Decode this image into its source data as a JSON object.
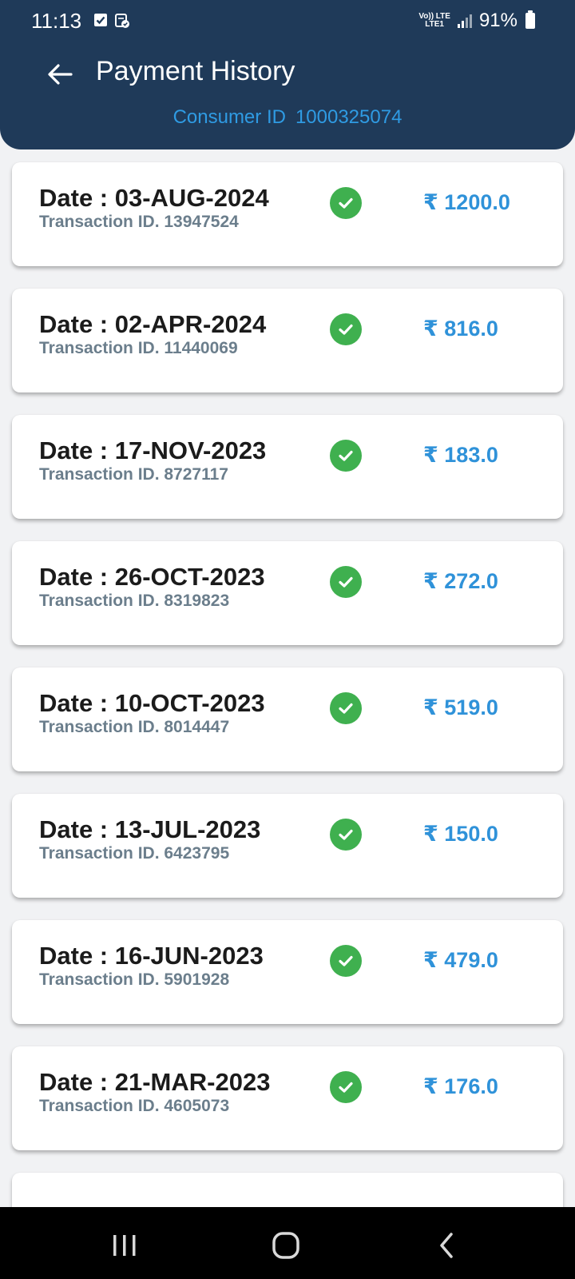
{
  "status_bar": {
    "time": "11:13",
    "network_top": "Vo)) LTE",
    "network_sub": "LTE1",
    "battery": "91%"
  },
  "header": {
    "title": "Payment History",
    "consumer_label": "Consumer ID",
    "consumer_id": "1000325074"
  },
  "colors": {
    "header_bg": "#1f3a59",
    "accent": "#2f92d9",
    "success": "#3fb04f"
  },
  "payments": [
    {
      "date": "Date : 03-AUG-2024",
      "transaction": "Transaction ID. 13947524",
      "amount": "₹ 1200.0",
      "status_icon": "check-circle-icon"
    },
    {
      "date": "Date : 02-APR-2024",
      "transaction": "Transaction ID. 11440069",
      "amount": "₹ 816.0",
      "status_icon": "check-circle-icon"
    },
    {
      "date": "Date : 17-NOV-2023",
      "transaction": "Transaction ID. 8727117",
      "amount": "₹ 183.0",
      "status_icon": "check-circle-icon"
    },
    {
      "date": "Date : 26-OCT-2023",
      "transaction": "Transaction ID. 8319823",
      "amount": "₹ 272.0",
      "status_icon": "check-circle-icon"
    },
    {
      "date": "Date : 10-OCT-2023",
      "transaction": "Transaction ID. 8014447",
      "amount": "₹ 519.0",
      "status_icon": "check-circle-icon"
    },
    {
      "date": "Date : 13-JUL-2023",
      "transaction": "Transaction ID. 6423795",
      "amount": "₹ 150.0",
      "status_icon": "check-circle-icon"
    },
    {
      "date": "Date : 16-JUN-2023",
      "transaction": "Transaction ID. 5901928",
      "amount": "₹ 479.0",
      "status_icon": "check-circle-icon"
    },
    {
      "date": "Date : 21-MAR-2023",
      "transaction": "Transaction ID. 4605073",
      "amount": "₹ 176.0",
      "status_icon": "check-circle-icon"
    }
  ],
  "nav": {
    "recents_icon": "recents-icon",
    "home_icon": "home-icon",
    "back_icon": "back-icon"
  }
}
